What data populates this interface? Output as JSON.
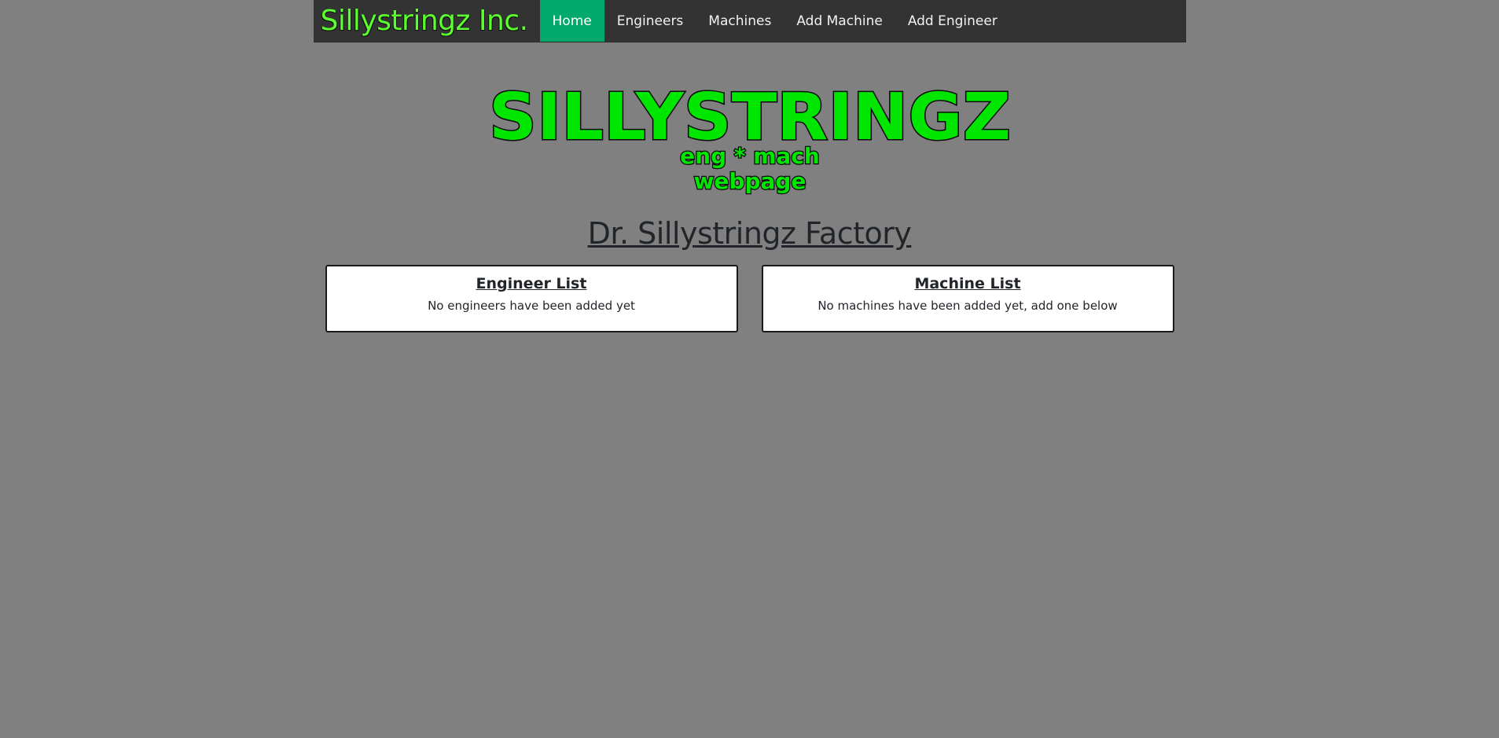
{
  "nav": {
    "brand": "Sillystringz Inc.",
    "links": [
      {
        "label": "Home",
        "active": true
      },
      {
        "label": "Engineers",
        "active": false
      },
      {
        "label": "Machines",
        "active": false
      },
      {
        "label": "Add Machine",
        "active": false
      },
      {
        "label": "Add Engineer",
        "active": false
      }
    ],
    "active_color": "#04aa6d",
    "brand_color": "#5cff2e"
  },
  "logo": {
    "title": "SILLYSTRINGZ",
    "line1": "eng * mach",
    "line2": "webpage",
    "fill_color": "#00e600"
  },
  "main": {
    "title": "Dr. Sillystringz Factory",
    "engineer_list": {
      "heading": "Engineer List",
      "empty_text": "No engineers have been added yet"
    },
    "machine_list": {
      "heading": "Machine List",
      "empty_text": "No machines have been added yet, add one below"
    }
  }
}
